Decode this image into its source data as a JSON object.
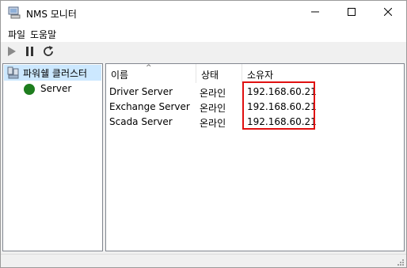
{
  "window": {
    "title": "NMS 모니터",
    "controls": {
      "minimize": "minimize-icon",
      "maximize": "maximize-icon",
      "close": "close-icon"
    }
  },
  "menu": {
    "items": [
      "파일",
      "도움말"
    ]
  },
  "toolbar": {
    "buttons": [
      "play-icon",
      "pause-icon",
      "refresh-icon"
    ]
  },
  "tree": {
    "root": {
      "label": "파워쉘 클러스터",
      "icon": "cluster-icon"
    },
    "children": [
      {
        "label": "Server",
        "status_color": "#1e7d1e"
      }
    ]
  },
  "list": {
    "columns": [
      "이름",
      "상태",
      "소유자"
    ],
    "sort_indicator": "^",
    "rows": [
      {
        "name": "Driver Server",
        "status": "온라인",
        "owner": "192.168.60.21"
      },
      {
        "name": "Exchange Server",
        "status": "온라인",
        "owner": "192.168.60.21"
      },
      {
        "name": "Scada Server",
        "status": "온라인",
        "owner": "192.168.60.21"
      }
    ]
  },
  "colors": {
    "highlight": "#e01010",
    "selection": "#cce8ff"
  }
}
